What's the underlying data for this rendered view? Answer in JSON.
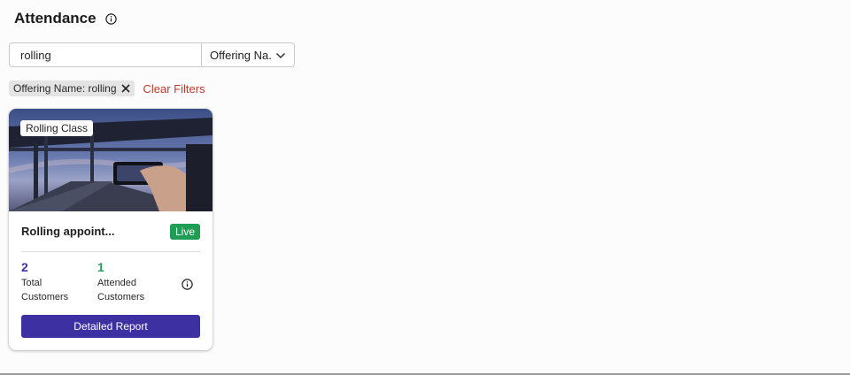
{
  "header": {
    "title": "Attendance",
    "info_icon": "info-icon"
  },
  "search": {
    "value": "rolling",
    "placeholder": "Search"
  },
  "filter_select": {
    "selected": "Offering Na...",
    "icon": "chevron-down-icon"
  },
  "active_filters": {
    "chips": [
      {
        "label": "Offering Name: rolling",
        "icon": "close-icon"
      }
    ],
    "clear_label": "Clear Filters"
  },
  "colors": {
    "accent": "#3d30a2",
    "live": "#1f9d55",
    "clear": "#c0392b"
  },
  "cards": [
    {
      "image_tag": "Rolling Class",
      "title": "Rolling appoint...",
      "status": "Live",
      "total_value": "2",
      "total_label": "Total Customers",
      "attended_value": "1",
      "attended_label": "Attended Customers",
      "info_icon": "info-icon",
      "button_label": "Detailed Report"
    }
  ]
}
